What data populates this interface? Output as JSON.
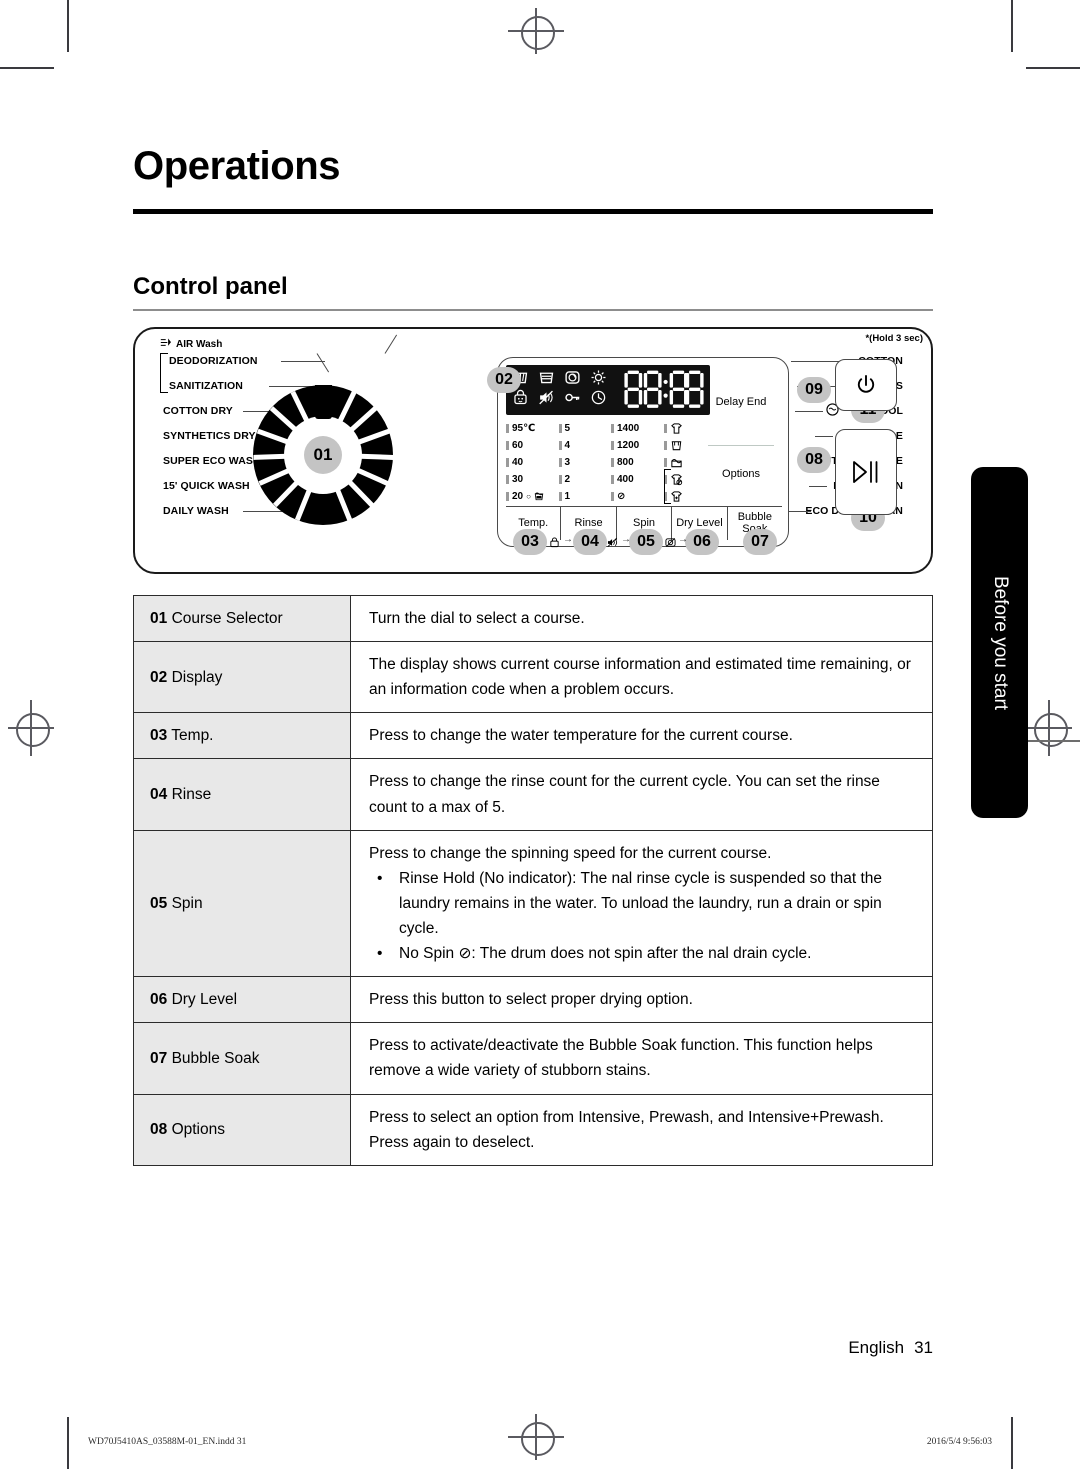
{
  "chapter": {
    "title": "Operations"
  },
  "section": {
    "title": "Control panel"
  },
  "panel": {
    "air_wash_label": "AIR Wash",
    "hold_note": "*(Hold 3 sec)",
    "dial_callout": "01",
    "left_labels": [
      "DEODORIZATION",
      "SANITIZATION",
      "COTTON DRY",
      "SYNTHETICS DRY",
      "SUPER ECO WASH",
      "15' QUICK WASH",
      "DAILY WASH"
    ],
    "right_labels": [
      "COTTON",
      "SYNTHETICS",
      "WOOL",
      "BABY CARE",
      "OUTDOOR CARE",
      "RINSE + SPIN",
      "ECO DRUM CLEAN"
    ],
    "display": {
      "segment_value": "88:88",
      "status_icons_row1": [
        "wash-tub-icon",
        "rinse-tub-icon",
        "spin-icon",
        "dry-sun-icon"
      ],
      "status_icons_row2": [
        "child-lock-icon",
        "sound-off-icon",
        "key-icon",
        "delay-clock-icon"
      ],
      "temp_values": [
        "95℃",
        "60",
        "40",
        "30",
        "20"
      ],
      "temp_cold_suffix": "○",
      "rinse_values": [
        "5",
        "4",
        "3",
        "2",
        "1"
      ],
      "spin_values": [
        "1400",
        "1200",
        "800",
        "400",
        "⊘"
      ],
      "dry_icons": [
        "shirt-dry-icon",
        "cotton-dry-icon",
        "synthetics-dry-icon",
        "air-wash-deodorize-icon",
        "air-wash-sanitize-icon"
      ],
      "delay_end_label": "Delay End",
      "options_label": "Options"
    },
    "buttons": [
      "Temp.",
      "Rinse",
      "Spin",
      "Dry Level",
      "Bubble Soak"
    ],
    "callouts": {
      "display": "02",
      "temp": "03",
      "rinse": "04",
      "spin": "05",
      "dry_level": "06",
      "bubble_soak": "07",
      "options": "08",
      "delay_end": "09",
      "start_pause": "10",
      "power": "11"
    },
    "keys": {
      "power_icon": "power-icon",
      "start_pause_icon": "start-pause-icon"
    }
  },
  "table": {
    "rows": [
      {
        "num": "01",
        "name": "Course Selector",
        "lines": [
          "Turn the dial to select a course."
        ],
        "bullets": []
      },
      {
        "num": "02",
        "name": "Display",
        "lines": [
          "The display shows current course information and estimated time remaining, or an information code when a problem occurs."
        ],
        "bullets": []
      },
      {
        "num": "03",
        "name": "Temp.",
        "lines": [
          "Press to change the water temperature for the current course."
        ],
        "bullets": []
      },
      {
        "num": "04",
        "name": "Rinse",
        "lines": [
          "Press to change the rinse count for the current cycle. You can set the rinse count to a max of 5."
        ],
        "bullets": []
      },
      {
        "num": "05",
        "name": "Spin",
        "lines": [
          "Press to change the spinning speed for the current course."
        ],
        "bullets": [
          "Rinse Hold (No indicator): The  nal rinse cycle is suspended so that the laundry remains in the water. To unload the laundry, run a drain or spin cycle.",
          "No Spin ⊘: The drum does not spin after the  nal drain cycle."
        ]
      },
      {
        "num": "06",
        "name": "Dry Level",
        "lines": [
          "Press this button to select proper drying option."
        ],
        "bullets": []
      },
      {
        "num": "07",
        "name": "Bubble Soak",
        "lines": [
          "Press to activate/deactivate the Bubble Soak function. This function helps remove a wide variety of stubborn stains."
        ],
        "bullets": []
      },
      {
        "num": "08",
        "name": "Options",
        "lines": [
          "Press to select an option from Intensive, Prewash, and Intensive+Prewash. Press again to deselect."
        ],
        "bullets": []
      }
    ]
  },
  "side_tab": {
    "label": "Before you start"
  },
  "footer": {
    "language": "English",
    "page_number": "31",
    "file_name": "WD70J5410AS_03588M-01_EN.indd   31",
    "timestamp": "2016/5/4   9:56:03"
  },
  "colors": {
    "callout_gray": "#c4c4c4",
    "header_gray": "#e8e8e8",
    "rule_black": "#000000"
  }
}
